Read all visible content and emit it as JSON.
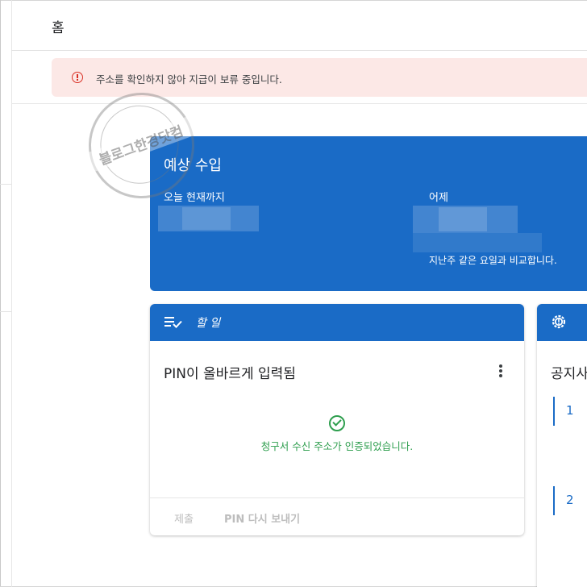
{
  "header": {
    "title": "홈"
  },
  "alert": {
    "text": "주소를 확인하지 않아 지급이 보류 중입니다.",
    "icon": "error-icon",
    "color": "#d93025",
    "background": "#fce8e6"
  },
  "watermark": {
    "text": "블로그한경닷컴"
  },
  "earnings": {
    "title": "예상 수입",
    "today_label": "오늘 현재까지",
    "yesterday_label": "어제",
    "comparison_note": "지난주 같은 요일과 비교합니다.",
    "color": "#1a6bc6"
  },
  "todo": {
    "header_title": "할 일",
    "header_icon": "checklist-icon",
    "task_title": "PIN이 올바르게 입력됨",
    "status_message": "청구서 수신 주소가 인증되었습니다.",
    "status_icon": "check-circle-icon",
    "status_color": "#2e9e4e",
    "submit_label": "제출",
    "resend_label": "PIN 다시 보내기"
  },
  "notice": {
    "header_icon": "gear-icon",
    "title": "공지사",
    "items": [
      "1",
      "2"
    ]
  }
}
